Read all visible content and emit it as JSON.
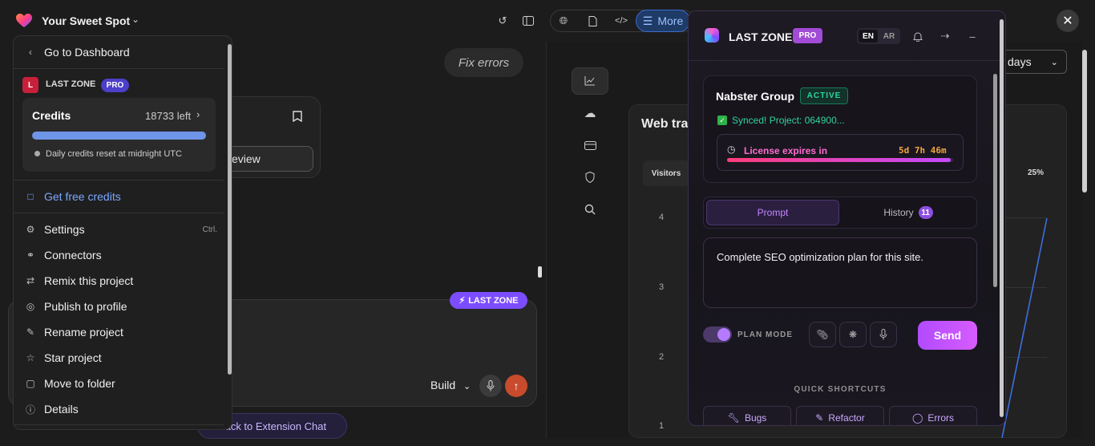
{
  "topbar": {
    "project_name": "Your Sweet Spot",
    "more_label": "More"
  },
  "chat": {
    "fix_errors_label": "Fix errors",
    "preview_button_label": "eview",
    "build_label": "Build",
    "badge_label": "LAST ZONE",
    "back_to_extension_label": "Back to Extension Chat"
  },
  "menu": {
    "go_dashboard": "Go to Dashboard",
    "workspace_initial": "L",
    "workspace_name": "LAST ZONE",
    "workspace_plan": "PRO",
    "credits_label": "Credits",
    "credits_left": "18733 left",
    "credits_progress": 1.0,
    "credits_reset": "Daily credits reset at midnight UTC",
    "get_free_credits": "Get free credits",
    "items": [
      {
        "label": "Settings",
        "shortcut": "Ctrl."
      },
      {
        "label": "Connectors"
      },
      {
        "label": "Remix this project"
      },
      {
        "label": "Publish to profile"
      },
      {
        "label": "Rename project"
      },
      {
        "label": "Star project"
      },
      {
        "label": "Move to folder"
      },
      {
        "label": "Details"
      }
    ]
  },
  "preview": {
    "web_traffic_title": "Web traf",
    "visitors_label": "Visitors",
    "percent": "25%",
    "days_label": "days",
    "y_ticks": [
      "4",
      "3",
      "2",
      "1"
    ]
  },
  "extension": {
    "title": "LAST ZONE",
    "plan": "PRO",
    "lang_en": "EN",
    "lang_ar": "AR",
    "group_name": "Nabster Group",
    "status": "ACTIVE",
    "synced_text": "Synced! Project: 064900...",
    "license_label": "License expires in",
    "license_time": "5d 7h 46m",
    "license_progress": 0.99,
    "tab_prompt": "Prompt",
    "tab_history": "History",
    "history_count": "11",
    "prompt_text": "Complete SEO optimization plan for this site.",
    "plan_mode_label": "PLAN MODE",
    "send_label": "Send",
    "quick_shortcuts_label": "QUICK SHORTCUTS",
    "shortcuts": [
      "Bugs",
      "Refactor",
      "Errors"
    ]
  }
}
